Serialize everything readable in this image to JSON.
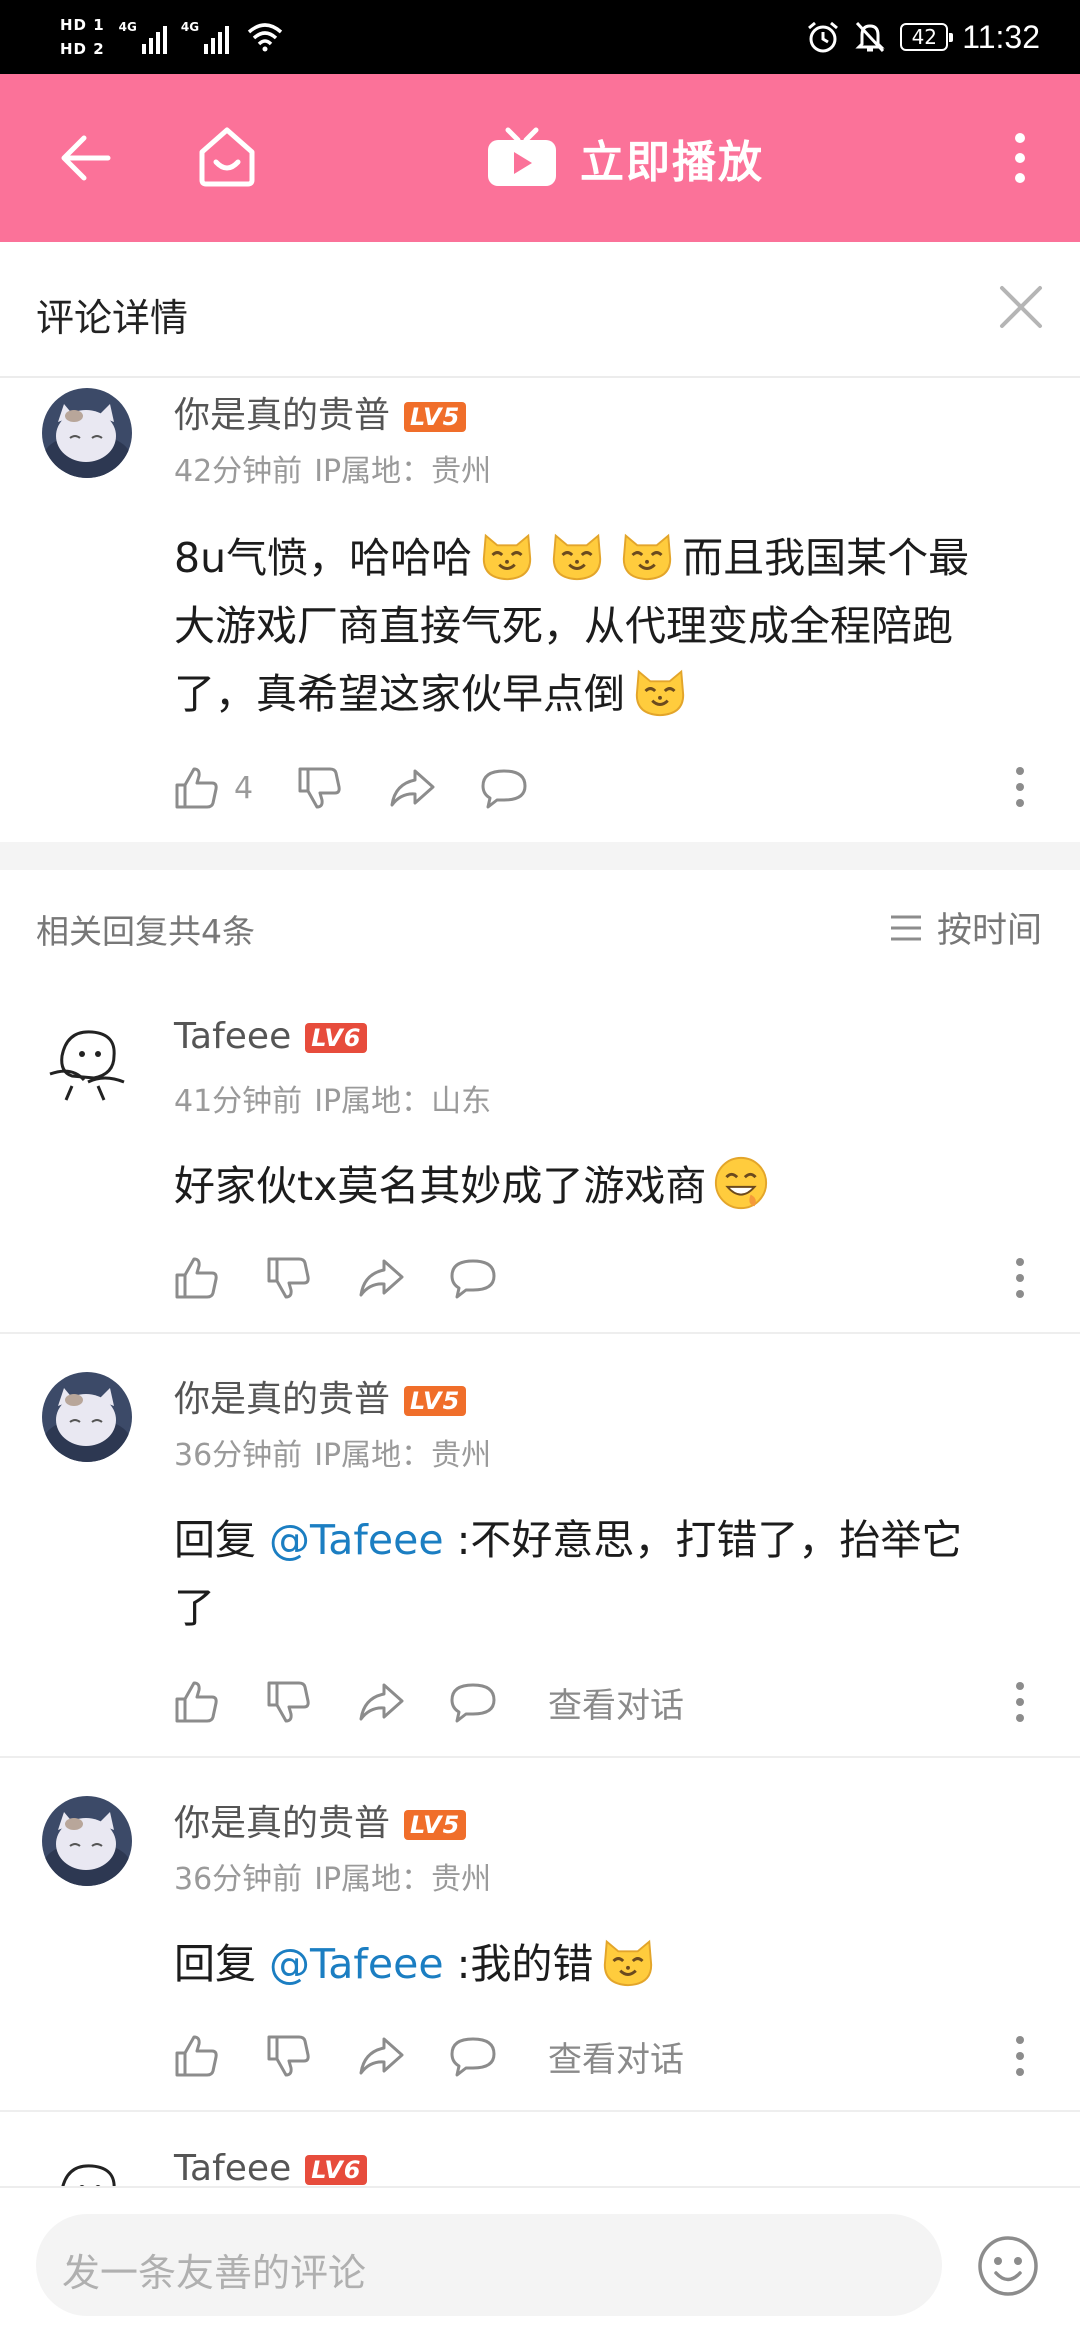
{
  "status_bar": {
    "hd1": "HD 1",
    "hd2": "HD 2",
    "net1": "4G",
    "net2": "4G",
    "battery": "42",
    "time": "11:32"
  },
  "app_bar": {
    "title": "立即播放",
    "accent": "#fb7299"
  },
  "panel": {
    "title": "评论详情"
  },
  "main_comment": {
    "username": "你是真的贵普",
    "level": "LV5",
    "level_color": "#f06e2a",
    "time": "42分钟前",
    "ip": "IP属地：贵州",
    "text_1": "8u气愤，哈哈哈",
    "text_2": "而且我国某个最",
    "text_3": "大游戏厂商直接气死，从代理变成全程陪跑",
    "text_4": "了，真希望这家伙早点倒",
    "likes": "4"
  },
  "replies_header": {
    "title": "相关回复共4条",
    "sort_label": "按时间"
  },
  "replies": [
    {
      "username": "Tafeee",
      "level": "LV6",
      "level_color": "#e74c3c",
      "time": "41分钟前",
      "ip": "IP属地：山东",
      "text": "好家伙tx莫名其妙成了游戏商"
    },
    {
      "username": "你是真的贵普",
      "level": "LV5",
      "level_color": "#f06e2a",
      "time": "36分钟前",
      "ip": "IP属地：贵州",
      "reply_prefix": "回复 ",
      "mention": "@Tafeee",
      "text_1": " :不好意思，打错了，抬举它",
      "text_2": "了",
      "view_conversation": "查看对话"
    },
    {
      "username": "你是真的贵普",
      "level": "LV5",
      "level_color": "#f06e2a",
      "time": "36分钟前",
      "ip": "IP属地：贵州",
      "reply_prefix": "回复 ",
      "mention": "@Tafeee",
      "text": " :我的错",
      "view_conversation": "查看对话"
    },
    {
      "username": "Tafeee",
      "level": "LV6",
      "level_color": "#e74c3c"
    }
  ],
  "input": {
    "placeholder": "发一条友善的评论"
  },
  "icons": [
    "back-icon",
    "home-icon",
    "tv-icon",
    "more-icon",
    "close-icon",
    "like-icon",
    "dislike-icon",
    "share-icon",
    "reply-icon",
    "sort-icon",
    "emoji-icon",
    "cat-emoji",
    "grin-emoji"
  ]
}
